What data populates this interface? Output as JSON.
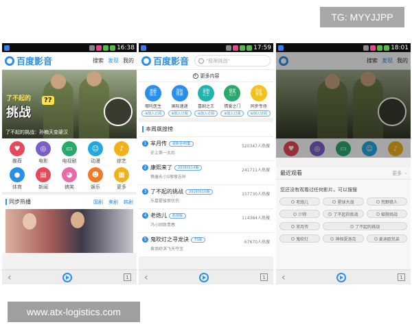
{
  "watermarks": {
    "top": "TG: MYYJJPP",
    "bottom": "www.atx-logistics.com"
  },
  "colors": {
    "accent": "#2a8fe8"
  },
  "phone1": {
    "time": "16:38",
    "logo": "百度影音",
    "nav": [
      "搜索",
      "发现",
      "我的"
    ],
    "nav_active": "发现",
    "banner": {
      "art_title": "挑战",
      "art_small": "了不起的",
      "art_badge": "??",
      "caption": "了不起的挑战：孙楠天变硬汉"
    },
    "categories": [
      {
        "label": "推荐",
        "icon": "heart-icon",
        "color": "#e8495a"
      },
      {
        "label": "电影",
        "icon": "glasses-icon",
        "color": "#7b5fc9"
      },
      {
        "label": "电视剧",
        "icon": "tv-icon",
        "color": "#2aaa6a"
      },
      {
        "label": "动漫",
        "icon": "face-icon",
        "color": "#22a9e0"
      },
      {
        "label": "综艺",
        "icon": "microphone-icon",
        "color": "#f0b21c"
      },
      {
        "label": "体育",
        "icon": "ball-icon",
        "color": "#2a8fe8"
      },
      {
        "label": "新闻",
        "icon": "news-icon",
        "color": "#e8495a"
      },
      {
        "label": "搞笑",
        "icon": "pig-icon",
        "color": "#e86aa8"
      },
      {
        "label": "娱乐",
        "icon": "smile-icon",
        "color": "#f07a2a"
      },
      {
        "label": "更多",
        "icon": "more-icon",
        "color": "#f0b21c"
      }
    ],
    "section": {
      "title": "同步热播",
      "links": [
        "国剧",
        "美剧",
        "韩剧"
      ]
    }
  },
  "phone2": {
    "time": "17:59",
    "logo": "百度影音",
    "search_placeholder": "\"极限挑战\"",
    "more_label": "更多内容",
    "bubbles": [
      {
        "inner": "奇葩<br>医生",
        "label": "哪吒医生",
        "btn": "⊕加入订阅",
        "color": "#2a8fe8"
      },
      {
        "inner": "国际<br>快递",
        "label": "国际速递",
        "btn": "⊕加入订阅",
        "color": "#2a8fe8"
      },
      {
        "inner": "喜剧<br>之王",
        "label": "喜剧之王",
        "btn": "⊕加入订阅",
        "color": "#1fb4b0"
      },
      {
        "inner": "情爱<br>之门",
        "label": "情爱之门",
        "btn": "⊕加入订阅",
        "color": "#2aaa6a"
      },
      {
        "inner": "同步<br>专场",
        "label": "同步专场",
        "btn": "⊕加入订阅",
        "color": "#f0c21c"
      }
    ],
    "rank_title": "本周飙搜榜",
    "rank": [
      {
        "num": "1",
        "name": "芈月传",
        "tag": "更新至45集",
        "heat": "520347人热搜",
        "desc": "史上第一太后"
      },
      {
        "num": "2",
        "name": "康熙来了",
        "tag": "20160114期",
        "heat": "241711人热搜",
        "desc": "蔡康永小S嗲嗲吉祥"
      },
      {
        "num": "3",
        "name": "了不起的挑战",
        "tag": "20160116期",
        "heat": "157730人热搜",
        "desc": "乐嘉霍骏恨忧伤"
      },
      {
        "num": "4",
        "name": "老炮儿",
        "tag": "影院版",
        "heat": "114384人热搜",
        "desc": "冯小刚致青春"
      },
      {
        "num": "5",
        "name": "鬼吹灯之寻龙诀",
        "tag": "TS版",
        "heat": "67670人热搜",
        "desc": "黄渤舒淇飞天夺宝"
      }
    ]
  },
  "phone3": {
    "time": "18:01",
    "nav": [
      "搜索",
      "发现",
      "我的"
    ],
    "nav_active": "发现",
    "recent_title": "最近观看",
    "recent_more": "更多",
    "recent_msg": "您还没有观看过任何影片，可以搜搜",
    "chips": [
      "老炮儿",
      "星球大战",
      "荒野猎人",
      "少帅",
      "了不起的挑战",
      "极限挑战",
      "芈月传",
      "了不起的挑战",
      "鬼吹灯",
      "神探夏洛克",
      "麦迪欧兄弟"
    ]
  },
  "bottom_page": "1"
}
